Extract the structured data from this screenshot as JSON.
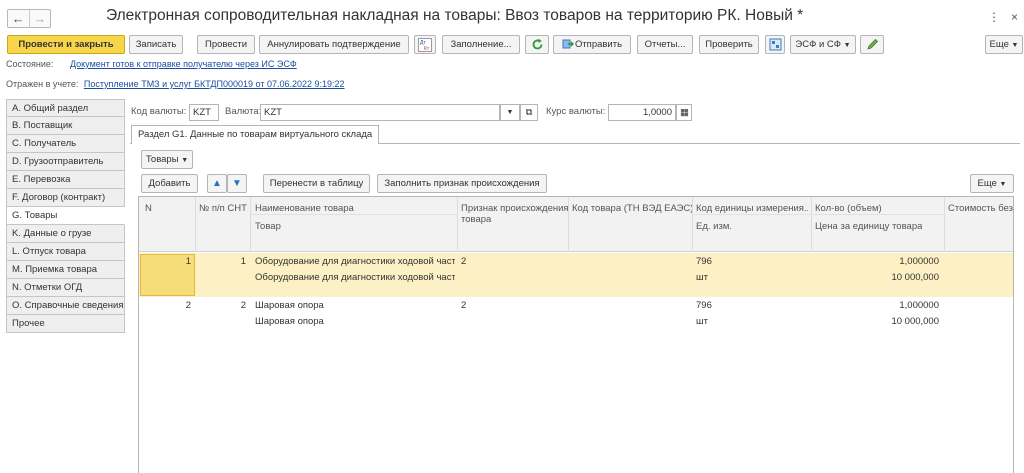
{
  "window": {
    "title": "Электронная сопроводительная накладная на товары: Ввоз товаров на территорию РК. Новый *",
    "back_glyph": "←",
    "forward_glyph": "→",
    "menu_glyph": "⋮",
    "close_glyph": "×"
  },
  "toolbar": {
    "post_close": "Провести и закрыть",
    "save": "Записать",
    "post": "Провести",
    "cancel_confirm": "Аннулировать подтверждение",
    "dt_kt": "Дт Кт",
    "fill": "Заполнение...",
    "send": "Отправить",
    "reports": "Отчеты...",
    "check": "Проверить",
    "esf_sf": "ЭСФ и СФ",
    "more": "Еще"
  },
  "status": {
    "state_label": "Состояние:",
    "state_link": "Документ готов к отправке получателю через ИС ЭСФ",
    "reflected_label": "Отражен в учете:",
    "reflected_link": "Поступление ТМЗ и услуг БКТДП000019 от 07.06.2022 9:19:22"
  },
  "sections": [
    {
      "label": "A. Общий раздел",
      "active": false
    },
    {
      "label": "B. Поставщик",
      "active": false
    },
    {
      "label": "C. Получатель",
      "active": false
    },
    {
      "label": "D. Грузоотправитель",
      "active": false
    },
    {
      "label": "E. Перевозка",
      "active": false
    },
    {
      "label": "F. Договор (контракт)",
      "active": false
    },
    {
      "label": "G. Товары",
      "active": true
    },
    {
      "label": "K. Данные о грузе",
      "active": false
    },
    {
      "label": "L. Отпуск товара",
      "active": false
    },
    {
      "label": "M. Приемка товара",
      "active": false
    },
    {
      "label": "N. Отметки ОГД",
      "active": false
    },
    {
      "label": "O. Справочные сведения",
      "active": false
    },
    {
      "label": "Прочее",
      "active": false
    }
  ],
  "currency": {
    "code_label": "Код валюты:",
    "code_value": "KZT",
    "currency_label": "Валюта:",
    "currency_value": "KZT",
    "rate_label": "Курс валюты:",
    "rate_value": "1,0000"
  },
  "tab": {
    "label": "Раздел G1. Данные по товарам виртуального склада"
  },
  "goods_toolbar": {
    "goods_menu": "Товары",
    "add": "Добавить",
    "transfer": "Перенести в таблицу",
    "fill_origin": "Заполнить признак происхождения",
    "more": "Еще"
  },
  "grid": {
    "headers": {
      "n": "N",
      "snt_no": "№ п/п СНТ",
      "name": "Наименование товара",
      "product": "Товар",
      "origin": "Признак происхождения товара",
      "code": "Код товара (ТН ВЭД ЕАЭС)",
      "unit_code": "Код единицы измерения...",
      "unit": "Ед. изм.",
      "qty": "Кол-во (объем)",
      "price": "Цена за единицу товара",
      "cost": "Стоимость без"
    },
    "rows": [
      {
        "n": "1",
        "snt_no": "1",
        "name": "Оборудование для диагностики ходовой части",
        "product": "Оборудование для диагностики ходовой части",
        "origin": "2",
        "code": "",
        "unit_code": "796",
        "unit": "шт",
        "qty": "1,000000",
        "price": "10 000,000",
        "selected": true
      },
      {
        "n": "2",
        "snt_no": "2",
        "name": "Шаровая опора",
        "product": "Шаровая опора",
        "origin": "2",
        "code": "",
        "unit_code": "796",
        "unit": "шт",
        "qty": "1,000000",
        "price": "10 000,000",
        "selected": false
      }
    ]
  }
}
